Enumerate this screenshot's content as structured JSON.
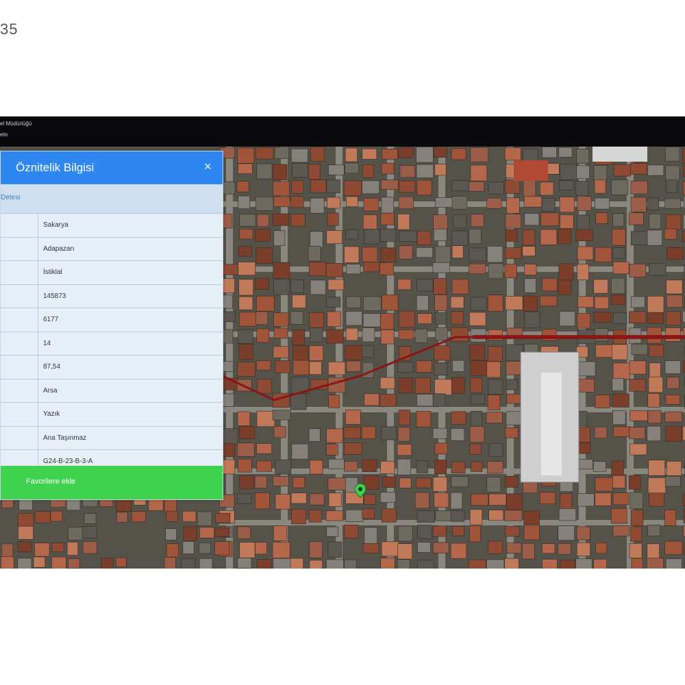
{
  "corner_number": "35",
  "topbar": {
    "line1": "el Müdürlüğü",
    "line2": "eto"
  },
  "panel": {
    "title": "Öznitelik Bilgisi",
    "close_symbol": "×",
    "section_label": "Detesi",
    "rows": [
      {
        "value": "Sakarya"
      },
      {
        "value": "Adapazarı"
      },
      {
        "value": "İstiklal"
      },
      {
        "value": "145873"
      },
      {
        "value": "6177"
      },
      {
        "value": "14"
      },
      {
        "value": "87,54"
      },
      {
        "value": "Arsa"
      },
      {
        "value": "Yazık"
      },
      {
        "value": "Ana Taşınmaz"
      },
      {
        "value": "G24-B-23-B-3-A"
      }
    ],
    "favorite_label": "Favorilere ekle"
  },
  "map": {
    "icon": "location-pin-icon",
    "route_color": "#8b1414",
    "pin_color": "#3ed24e"
  }
}
